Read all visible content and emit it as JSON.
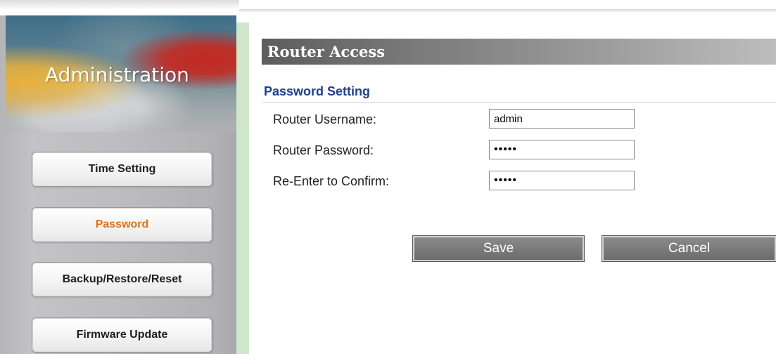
{
  "sidebar": {
    "banner_title": "Administration",
    "items": [
      {
        "label": "Time Setting",
        "active": false
      },
      {
        "label": "Password",
        "active": true
      },
      {
        "label": "Backup/Restore/Reset",
        "active": false
      },
      {
        "label": "Firmware Update",
        "active": false
      }
    ]
  },
  "main": {
    "page_title": "Router Access",
    "section_title": "Password Setting",
    "fields": {
      "username": {
        "label": "Router Username:",
        "value": "admin"
      },
      "password": {
        "label": "Router Password:",
        "value": "•••••"
      },
      "confirm": {
        "label": "Re-Enter to Confirm:",
        "value": "•••••"
      }
    },
    "buttons": {
      "save": "Save",
      "cancel": "Cancel"
    }
  },
  "colors": {
    "active_nav": "#e2731a",
    "section_title": "#1c3e9b",
    "content_border": "#cde8c9"
  }
}
